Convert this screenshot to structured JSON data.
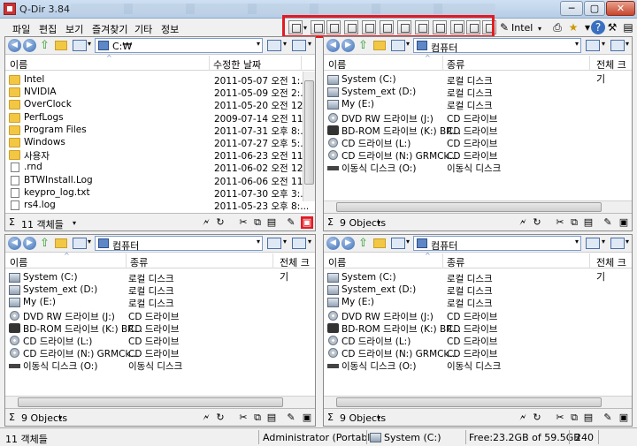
{
  "window": {
    "title": "Q-Dir 3.84",
    "min": "─",
    "max": "▢",
    "close": "✕"
  },
  "menu": [
    "파일",
    "편집",
    "보기",
    "즐겨찾기",
    "기타",
    "정보"
  ],
  "toolbar": {
    "font_label": "Intel"
  },
  "columns": {
    "name": "이름",
    "modified": "수정한 날짜",
    "type": "종류",
    "size": "전체 크기"
  },
  "pane1": {
    "address": "C:₩",
    "status": "11 객체들",
    "rows": [
      {
        "icon": "folder",
        "name": "Intel",
        "date": "2011-05-07 오전 1:..."
      },
      {
        "icon": "folder",
        "name": "NVIDIA",
        "date": "2011-05-09 오전 2:..."
      },
      {
        "icon": "folder",
        "name": "OverClock",
        "date": "2011-05-20 오전 12..."
      },
      {
        "icon": "folder",
        "name": "PerfLogs",
        "date": "2009-07-14 오전 11:..."
      },
      {
        "icon": "folder",
        "name": "Program Files",
        "date": "2011-07-31 오후 8:..."
      },
      {
        "icon": "folder",
        "name": "Windows",
        "date": "2011-07-27 오후 5:..."
      },
      {
        "icon": "folder",
        "name": "사용자",
        "date": "2011-06-23 오전 11:..."
      },
      {
        "icon": "file",
        "name": ".rnd",
        "date": "2011-06-02 오전 12..."
      },
      {
        "icon": "file",
        "name": "BTWInstall.Log",
        "date": "2011-06-06 오전 11:..."
      },
      {
        "icon": "file",
        "name": "keypro_log.txt",
        "date": "2011-07-30 오후 3:..."
      },
      {
        "icon": "file",
        "name": "rs4.log",
        "date": "2011-05-23 오후 8:..."
      }
    ]
  },
  "computer": {
    "address": "컴퓨터",
    "status": "9 Objects",
    "rows": [
      {
        "icon": "drive",
        "name": "System (C:)",
        "type": "로컬 디스크"
      },
      {
        "icon": "drive",
        "name": "System_ext (D:)",
        "type": "로컬 디스크"
      },
      {
        "icon": "drive",
        "name": "My (E:)",
        "type": "로컬 디스크"
      },
      {
        "icon": "cd",
        "name": "DVD RW 드라이브 (J:)",
        "type": "CD 드라이브"
      },
      {
        "icon": "bd",
        "name": "BD-ROM 드라이브 (K:) BR...",
        "type": "CD 드라이브"
      },
      {
        "icon": "cd",
        "name": "CD 드라이브 (L:)",
        "type": "CD 드라이브"
      },
      {
        "icon": "cd",
        "name": "CD 드라이브 (N:) GRMCk...",
        "type": "CD 드라이브"
      },
      {
        "icon": "usb",
        "name": "이동식 디스크 (O:)",
        "type": "이동식 디스크"
      }
    ]
  },
  "statusbar": {
    "objects": "11 객체들",
    "user": "Administrator (Portable)",
    "drive": "System (C:)",
    "free": "Free:23.2GB of 59.5GB",
    "num": "240"
  },
  "icons": {
    "sigma": "Σ",
    "dropdown": "▾",
    "refresh": "🗲",
    "cut": "✂",
    "copy": "⧉",
    "paste": "▤",
    "rename": "✎",
    "properties": "▣",
    "up": "⇧",
    "back": "◀",
    "forward": "▶"
  }
}
